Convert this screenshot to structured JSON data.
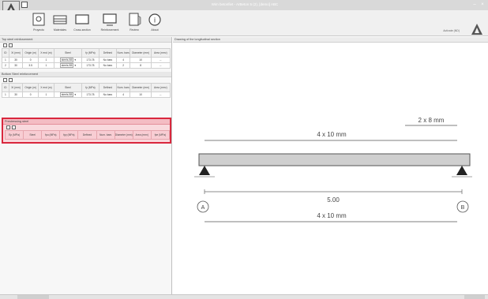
{
  "window": {
    "title": "Wim betonfiet - ArBeton 5 (2), [demo] ABC"
  },
  "ribbon": {
    "items": [
      {
        "label": "Proyecto",
        "icon": "project-icon"
      },
      {
        "label": "Materiales",
        "icon": "materials-icon"
      },
      {
        "label": "Cross-section",
        "icon": "cross-section-icon"
      },
      {
        "label": "Reinforcement",
        "icon": "reinforcement-icon"
      },
      {
        "label": "Review",
        "icon": "review-icon"
      },
      {
        "label": "About",
        "icon": "about-icon"
      }
    ],
    "user": "Activate (ND)"
  },
  "top_steel": {
    "title": "Top steel reinforcement",
    "headers": [
      "ID",
      "Xi (mm)",
      "Origin (m)",
      "X end (m)",
      "Steel",
      "fy (MPa)",
      "Defined",
      "Num. bars",
      "Diameter (mm)",
      "Area (mm²)"
    ],
    "rows": [
      [
        "1",
        "30",
        "0",
        "1",
        "steels-B5",
        "173.78",
        "No bars",
        "4",
        "10",
        "--"
      ],
      [
        "2",
        "30",
        "3.5",
        "1",
        "steels-B5",
        "173.78",
        "No bars",
        "2",
        "8",
        "--"
      ]
    ]
  },
  "bottom_steel": {
    "title": "Bottom Steel reinforcement",
    "headers": [
      "ID",
      "Xi (mm)",
      "Origin (m)",
      "X end (m)",
      "Steel",
      "fy (MPa)",
      "Defined",
      "Num. bars",
      "Diameter (mm)",
      "Area (mm²)"
    ],
    "rows": [
      [
        "1",
        "30",
        "0",
        "1",
        "steels-B5",
        "173.78",
        "No bars",
        "4",
        "10",
        "--"
      ]
    ]
  },
  "prestressing": {
    "title": "Prestressing steel",
    "headers": [
      "Ep (MPa)",
      "Steel",
      "fpu (MPa)",
      "fpy (MPa)",
      "Defined",
      "Num. bars",
      "Diameter (mm)",
      "Area (mm²)",
      "fpe (MPa)"
    ]
  },
  "drawing": {
    "title": "Drawing of the longitudinal section",
    "top_label_short": "2 x 8 mm",
    "top_label_long": "4 x 10 mm",
    "span_label": "5.00",
    "bottom_label": "4 x 10 mm",
    "support_a": "A",
    "support_b": "B"
  },
  "colors": {
    "accent_red": "#d9273d",
    "highlight_fill": "#f9d9dd"
  }
}
